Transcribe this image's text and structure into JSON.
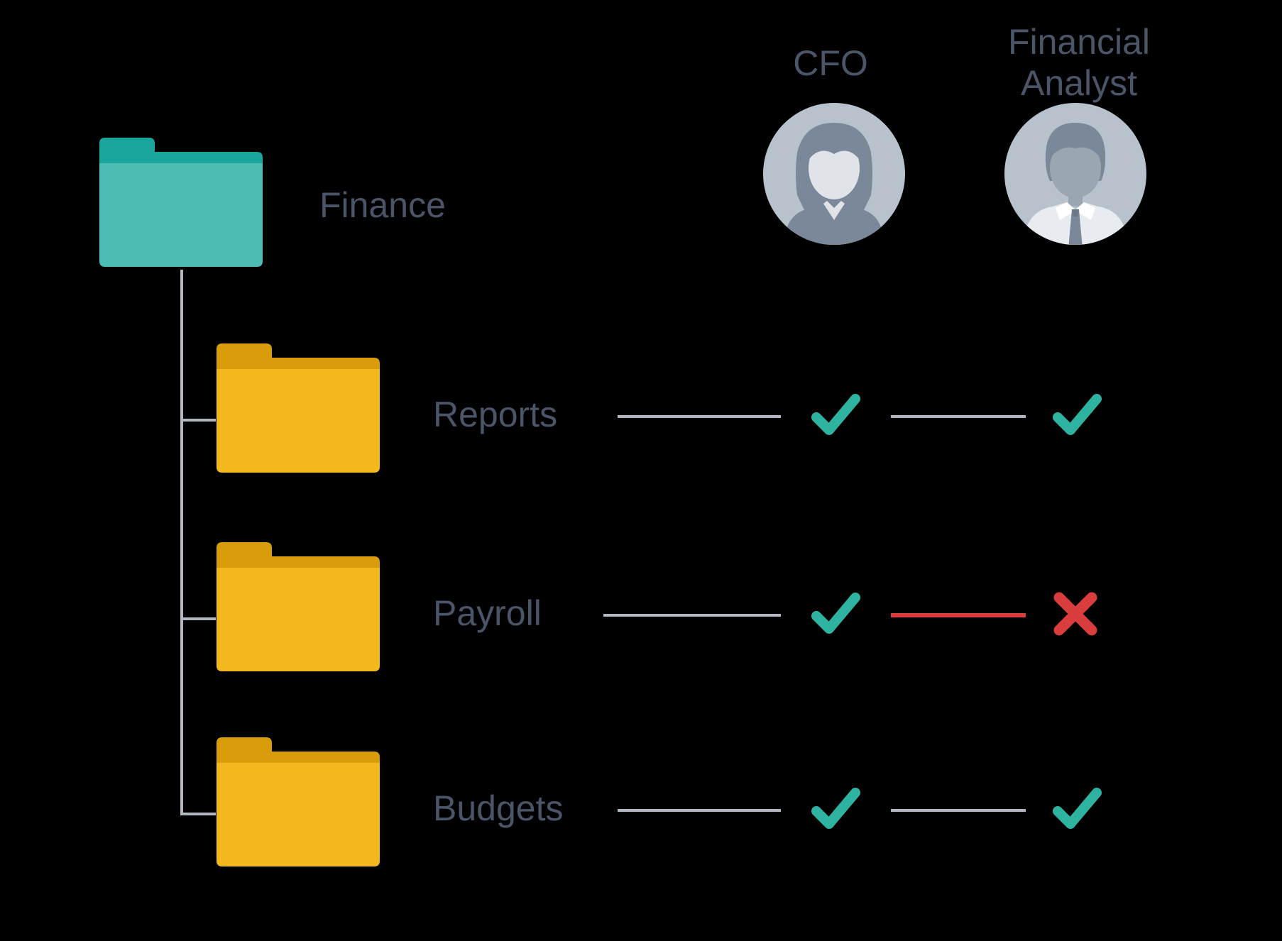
{
  "root": {
    "label": "Finance"
  },
  "folders": [
    {
      "label": "Reports"
    },
    {
      "label": "Payroll"
    },
    {
      "label": "Budgets"
    }
  ],
  "roles": [
    {
      "label": "CFO"
    },
    {
      "label": "Financial\nAnalyst"
    }
  ],
  "permissions": [
    {
      "folder": "Reports",
      "cfo": "allow",
      "analyst": "allow"
    },
    {
      "folder": "Payroll",
      "cfo": "allow",
      "analyst": "deny"
    },
    {
      "folder": "Budgets",
      "cfo": "allow",
      "analyst": "allow"
    }
  ],
  "colors": {
    "folder_teal": "#4dbdb3",
    "folder_teal_dark": "#1aa69c",
    "folder_yellow": "#f2b81e",
    "folder_yellow_dark": "#d99c0b",
    "check": "#2eb3a1",
    "cross": "#d93d3d",
    "text": "#4a5568",
    "line": "#b0b7c0",
    "avatar_bg": "#b8c2cc",
    "avatar_fg": "#7a8899"
  }
}
